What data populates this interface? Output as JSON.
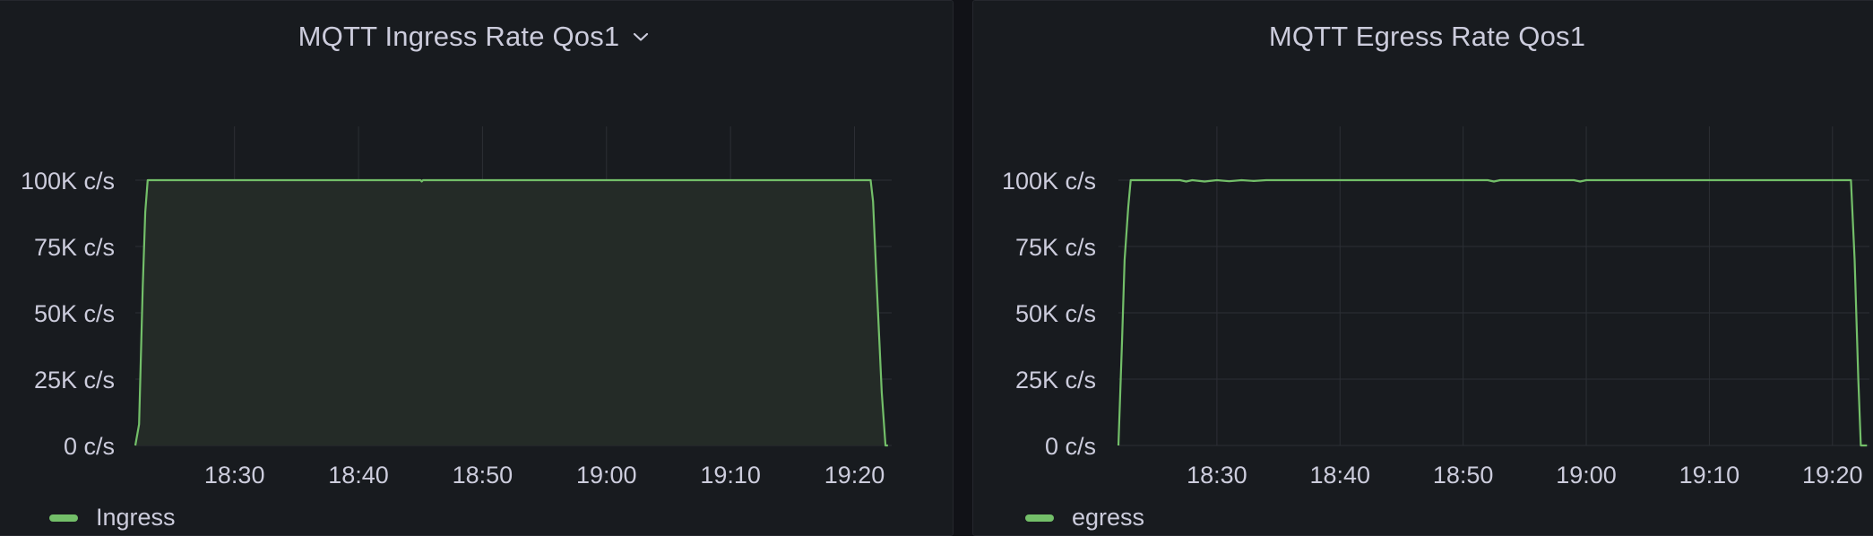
{
  "panels": [
    {
      "title": "MQTT Ingress Rate Qos1",
      "has_menu_chevron": true,
      "icon": "chevron-down-icon",
      "legend": {
        "label": "Ingress"
      }
    },
    {
      "title": "MQTT Egress Rate Qos1",
      "has_menu_chevron": false,
      "legend": {
        "label": "egress"
      }
    }
  ],
  "colors": {
    "background": "#181b1f",
    "grid": "#2c2f35",
    "text": "#ccccdc",
    "series": "#73bf69",
    "ingress_fill": "#242b27"
  },
  "chart_data": [
    {
      "type": "area",
      "title": "MQTT Ingress Rate Qos1",
      "x_axis": {
        "type": "time",
        "range": [
          "18:22",
          "19:23"
        ],
        "ticks": [
          "18:30",
          "18:40",
          "18:50",
          "19:00",
          "19:10",
          "19:20"
        ]
      },
      "y_axis": {
        "unit": "c/s",
        "range": [
          0,
          100000
        ],
        "ticks": [
          "0 c/s",
          "25K c/s",
          "50K c/s",
          "75K c/s",
          "100K c/s"
        ]
      },
      "grid": true,
      "legend_position": "bottom-left",
      "series": [
        {
          "name": "Ingress",
          "points": [
            [
              "18:22",
              0
            ],
            [
              "18:22.3",
              8000
            ],
            [
              "18:22.6",
              60000
            ],
            [
              "18:22.8",
              88000
            ],
            [
              "18:23",
              100000
            ],
            [
              "18:45",
              100000
            ],
            [
              "18:45.1",
              99500
            ],
            [
              "18:45.2",
              100000
            ],
            [
              "19:21.3",
              100000
            ],
            [
              "19:21.5",
              92000
            ],
            [
              "19:21.8",
              60000
            ],
            [
              "19:22.2",
              20000
            ],
            [
              "19:22.5",
              0
            ],
            [
              "19:22.7",
              0
            ]
          ]
        }
      ]
    },
    {
      "type": "line",
      "title": "MQTT Egress Rate Qos1",
      "x_axis": {
        "type": "time",
        "range": [
          "18:22",
          "19:23"
        ],
        "ticks": [
          "18:30",
          "18:40",
          "18:50",
          "19:00",
          "19:10",
          "19:20"
        ]
      },
      "y_axis": {
        "unit": "c/s",
        "range": [
          0,
          100000
        ],
        "ticks": [
          "0 c/s",
          "25K c/s",
          "50K c/s",
          "75K c/s",
          "100K c/s"
        ]
      },
      "grid": true,
      "legend_position": "bottom-left",
      "series": [
        {
          "name": "egress",
          "points": [
            [
              "18:22",
              0
            ],
            [
              "18:22.3",
              40000
            ],
            [
              "18:22.5",
              70000
            ],
            [
              "18:22.8",
              90000
            ],
            [
              "18:23",
              100000
            ],
            [
              "18:27",
              100000
            ],
            [
              "18:27.5",
              99500
            ],
            [
              "18:28",
              100000
            ],
            [
              "18:29",
              99500
            ],
            [
              "18:30",
              100000
            ],
            [
              "18:31",
              99600
            ],
            [
              "18:32",
              100000
            ],
            [
              "18:33",
              99700
            ],
            [
              "18:34",
              100000
            ],
            [
              "18:52",
              100000
            ],
            [
              "18:52.5",
              99500
            ],
            [
              "18:53",
              100000
            ],
            [
              "18:59",
              100000
            ],
            [
              "18:59.5",
              99500
            ],
            [
              "19:00",
              100000
            ],
            [
              "19:21.5",
              100000
            ],
            [
              "19:21.8",
              70000
            ],
            [
              "19:22.1",
              25000
            ],
            [
              "19:22.3",
              0
            ],
            [
              "19:22.8",
              0
            ]
          ]
        }
      ]
    }
  ]
}
